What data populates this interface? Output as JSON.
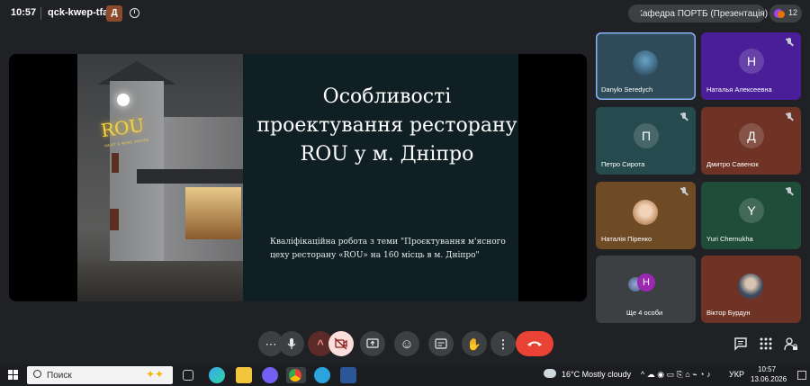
{
  "meeting": {
    "time": "10:57",
    "code": "qck-kwep-tfa",
    "badge_glyph": "Д",
    "info_glyph": "i",
    "presenter_chip": "Кафедра ПОРТБ (Презентація)",
    "participant_count": "12"
  },
  "slide": {
    "title": "Особливості проектування ресторану ROU у м. Дніпро",
    "subtitle": "Кваліфікаційна робота з теми \"Проєктування м'ясного цеху ресторану «ROU» на 160 місць в м. Дніпро\"",
    "photo_logo": "ROU",
    "photo_logo_sub": "MEAT & WINE HOUSE"
  },
  "participants": [
    {
      "name": "Danylo Seredych",
      "initial": "",
      "color": "#2f4a58",
      "muted": false,
      "photo": true
    },
    {
      "name": "Наталья Алексеевна",
      "initial": "Н",
      "color": "#4a1e99",
      "muted": true,
      "photo": false
    },
    {
      "name": "Петро Сирота",
      "initial": "П",
      "color": "#264b4e",
      "muted": true,
      "photo": false
    },
    {
      "name": "Дмитро Савенок",
      "initial": "Д",
      "color": "#6e3325",
      "muted": true,
      "photo": false
    },
    {
      "name": "Наталія Піренко",
      "initial": "",
      "color": "#6e4a25",
      "muted": true,
      "photo": true
    },
    {
      "name": "Yuri Chernukha",
      "initial": "Y",
      "color": "#1f4d3a",
      "muted": true,
      "photo": false
    },
    {
      "name": "Ще 4 особи",
      "initial": "H",
      "color": "#3c4043",
      "muted": false,
      "photo": false
    },
    {
      "name": "Віктор Бурдун",
      "initial": "",
      "color": "#6e3325",
      "muted": false,
      "photo": true
    }
  ],
  "controls": {
    "more_glyph": "⋯",
    "mic_glyph": "🎙",
    "chevron_glyph": "^",
    "cam_off_glyph": "⌧",
    "present_glyph": "⇧",
    "emoji_glyph": "☺",
    "captions_glyph": "CC",
    "hand_glyph": "✋",
    "options_glyph": "⋮",
    "leave_glyph": "☎"
  },
  "taskbar": {
    "search_placeholder": "Поиск",
    "weather": "16°C  Mostly cloudy",
    "language": "УКР",
    "clock_time": "10:57",
    "clock_date": "13.06.2026"
  },
  "colors": {
    "background": "#202124",
    "leave_red": "#ea4335",
    "active_border": "#8ab4f8",
    "slide_bg": "#0f1f23"
  }
}
